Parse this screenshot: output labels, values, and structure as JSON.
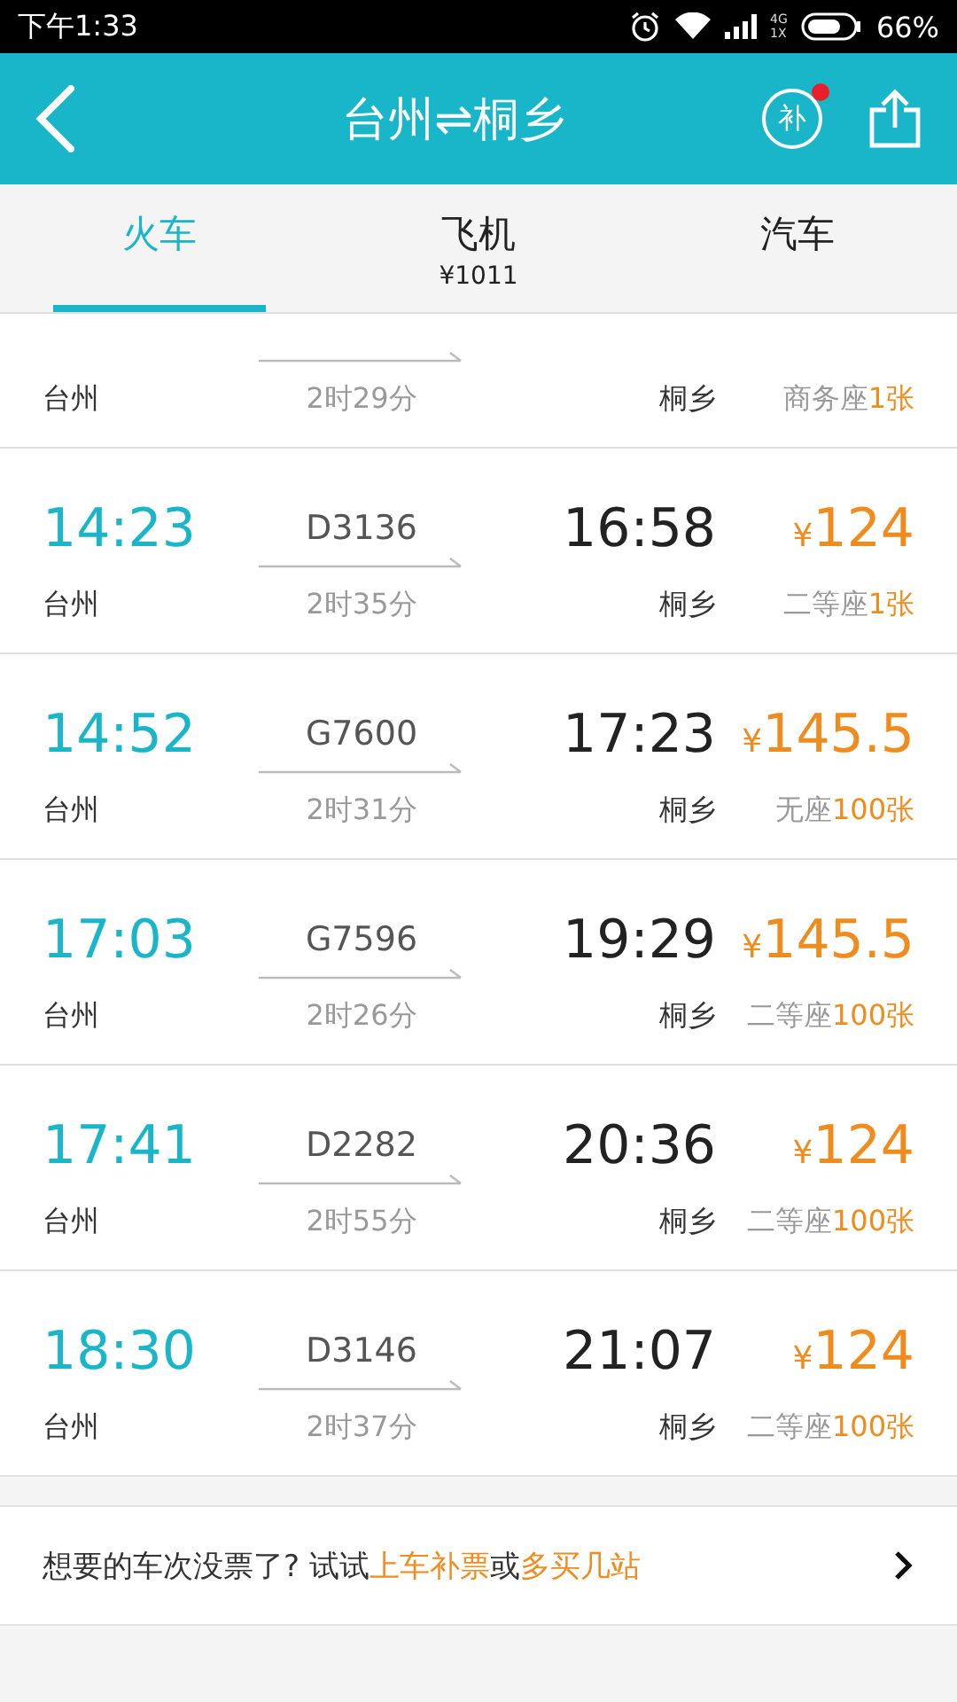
{
  "status_bar": {
    "time": "下午1:33",
    "network": [
      "4G",
      "1X"
    ],
    "battery": "66%"
  },
  "header": {
    "title": "台州⇌桐乡",
    "supplement_icon": "补",
    "supplement_badge": true
  },
  "tabs": [
    {
      "label": "火车",
      "selected": true
    },
    {
      "label": "飞机",
      "price": "¥1011",
      "selected": false
    },
    {
      "label": "汽车",
      "selected": false
    }
  ],
  "trains": [
    {
      "kind": "cut",
      "from": "台州",
      "duration": "2时29分",
      "to": "桐乡",
      "seat": "商务座",
      "tickets": "1张"
    },
    {
      "depart": "14:23",
      "from": "台州",
      "number": "D3136",
      "duration": "2时35分",
      "arrive": "16:58",
      "to": "桐乡",
      "currency": "¥",
      "price": "124",
      "seat": "二等座",
      "tickets": "1张"
    },
    {
      "depart": "14:52",
      "from": "台州",
      "number": "G7600",
      "duration": "2时31分",
      "arrive": "17:23",
      "to": "桐乡",
      "currency": "¥",
      "price": "145.5",
      "seat": "无座",
      "tickets": "100张"
    },
    {
      "depart": "17:03",
      "from": "台州",
      "number": "G7596",
      "duration": "2时26分",
      "arrive": "19:29",
      "to": "桐乡",
      "currency": "¥",
      "price": "145.5",
      "seat": "二等座",
      "tickets": "100张"
    },
    {
      "depart": "17:41",
      "from": "台州",
      "number": "D2282",
      "duration": "2时55分",
      "arrive": "20:36",
      "to": "桐乡",
      "currency": "¥",
      "price": "124",
      "seat": "二等座",
      "tickets": "100张"
    },
    {
      "depart": "18:30",
      "from": "台州",
      "number": "D3146",
      "duration": "2时37分",
      "arrive": "21:07",
      "to": "桐乡",
      "currency": "¥",
      "price": "124",
      "seat": "二等座",
      "tickets": "100张"
    }
  ],
  "notice": [
    {
      "kind": "plain",
      "text": "想要的车次没票了? 试试"
    },
    {
      "kind": "link",
      "text": "上车补票"
    },
    {
      "kind": "plain",
      "text": "或"
    },
    {
      "kind": "link",
      "text": "多买几站"
    }
  ]
}
